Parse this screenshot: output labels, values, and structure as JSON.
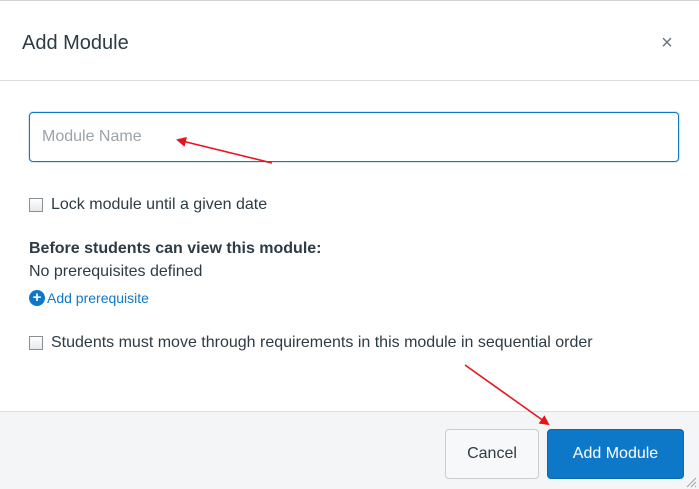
{
  "dialog": {
    "title": "Add Module",
    "close_glyph": "×",
    "close_icon": "close-icon"
  },
  "form": {
    "name_placeholder": "Module Name",
    "name_value": "",
    "lock_label": "Lock module until a given date",
    "prereq_heading": "Before students can view this module:",
    "prereq_status": "No prerequisites defined",
    "add_prereq_label": "Add prerequisite",
    "add_prereq_icon": "plus-circle-icon",
    "sequential_label": "Students must move through requirements in this module in sequential order"
  },
  "footer": {
    "cancel_label": "Cancel",
    "submit_label": "Add Module"
  },
  "colors": {
    "accent": "#0e78c8",
    "annotation_arrow": "#e8141b",
    "text": "#2d3b45",
    "footer_bg": "#f4f5f6"
  }
}
